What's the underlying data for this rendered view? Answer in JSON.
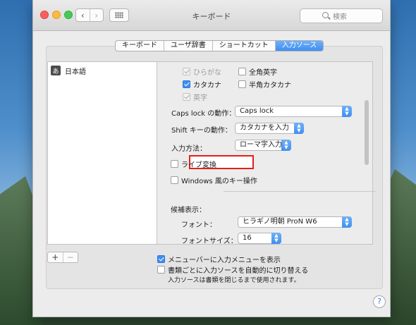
{
  "window": {
    "title": "キーボード"
  },
  "search": {
    "placeholder": "検索"
  },
  "nav": {
    "back": "‹",
    "forward": "›"
  },
  "tabs": [
    {
      "label": "キーボード",
      "active": false
    },
    {
      "label": "ユーザ辞書",
      "active": false
    },
    {
      "label": "ショートカット",
      "active": false
    },
    {
      "label": "入力ソース",
      "active": true
    }
  ],
  "sources": [
    {
      "icon": "あ",
      "label": "日本語"
    }
  ],
  "list_buttons": {
    "add": "+",
    "remove": "−"
  },
  "input_modes": {
    "hiragana": {
      "label": "ひらがな",
      "checked": true,
      "disabled": true
    },
    "zenkaku_eiji": {
      "label": "全角英字",
      "checked": false
    },
    "katakana": {
      "label": "カタカナ",
      "checked": true
    },
    "hankaku_katakana": {
      "label": "半角カタカナ",
      "checked": false
    },
    "eiji": {
      "label": "英字",
      "checked": true,
      "disabled": true
    }
  },
  "settings": {
    "caps_lock": {
      "label": "Caps lock の動作：",
      "value": "Caps lock"
    },
    "shift": {
      "label": "Shift キーの動作：",
      "value": "カタカナを入力"
    },
    "input_method": {
      "label": "入力方法：",
      "value": "ローマ字入力"
    }
  },
  "live_conversion": {
    "label": "ライブ変換",
    "checked": false,
    "highlighted": true
  },
  "windows_keys": {
    "label": "Windows 風のキー操作",
    "checked": false
  },
  "candidates": {
    "title": "候補表示：",
    "font_label": "フォント：",
    "font_value": "ヒラギノ明朝 ProN W6",
    "size_label": "フォントサイズ：",
    "size_value": "16"
  },
  "footer": {
    "show_menu": {
      "label": "メニューバーに入力メニューを表示",
      "checked": true
    },
    "auto_switch": {
      "label": "書類ごとに入力ソースを自動的に切り替える",
      "checked": false
    },
    "note": "入力ソースは書類を閉じるまで使用されます。"
  },
  "help": "?",
  "colors": {
    "accent": "#3f8ef1",
    "highlight_border": "#e0201c",
    "close": "#fc605c",
    "minimize": "#fcbb40",
    "zoom": "#34c84a"
  },
  "icons": {
    "close": "close-icon",
    "search": "search-icon",
    "grid": "grid-icon",
    "popup": "chevron-updown-icon"
  }
}
